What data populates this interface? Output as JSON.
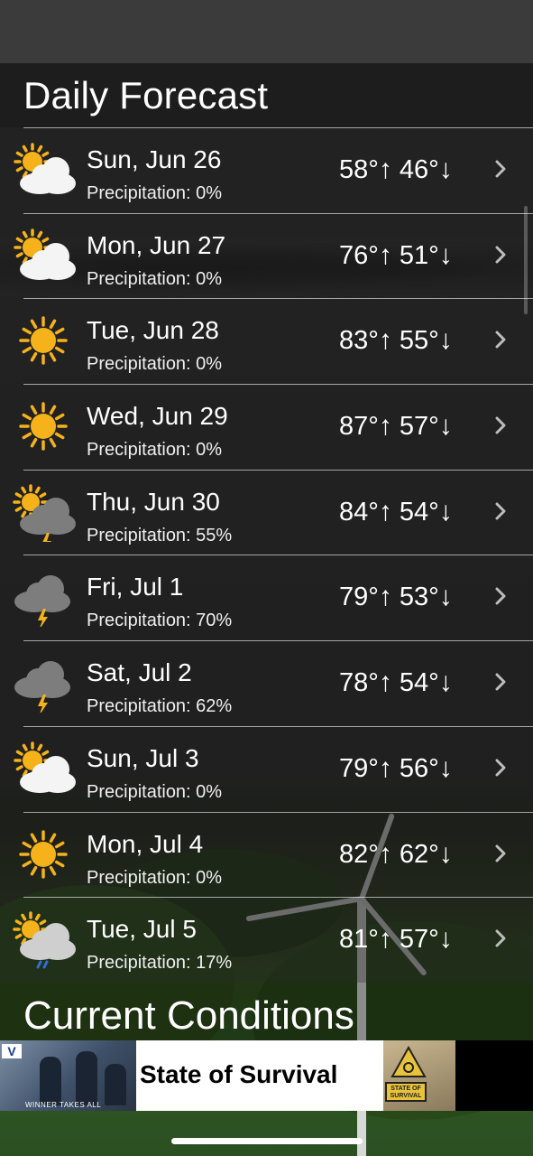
{
  "header": {
    "title": "Daily Forecast"
  },
  "units": {
    "high_arrow": "↑",
    "low_arrow": "↓",
    "deg": "°"
  },
  "forecast": [
    {
      "day": "Sun, Jun 26",
      "precipitation": "Precipitation: 0%",
      "high": "58°",
      "low": "46°",
      "icon": "partly-cloudy-icon"
    },
    {
      "day": "Mon, Jun 27",
      "precipitation": "Precipitation: 0%",
      "high": "76°",
      "low": "51°",
      "icon": "partly-cloudy-icon"
    },
    {
      "day": "Tue, Jun 28",
      "precipitation": "Precipitation: 0%",
      "high": "83°",
      "low": "55°",
      "icon": "sunny-icon"
    },
    {
      "day": "Wed, Jun 29",
      "precipitation": "Precipitation: 0%",
      "high": "87°",
      "low": "57°",
      "icon": "sunny-icon"
    },
    {
      "day": "Thu, Jun 30",
      "precipitation": "Precipitation: 55%",
      "high": "84°",
      "low": "54°",
      "icon": "partly-sunny-thunderstorm-icon"
    },
    {
      "day": "Fri, Jul 1",
      "precipitation": "Precipitation: 70%",
      "high": "79°",
      "low": "53°",
      "icon": "thunderstorm-icon"
    },
    {
      "day": "Sat, Jul 2",
      "precipitation": "Precipitation: 62%",
      "high": "78°",
      "low": "54°",
      "icon": "thunderstorm-icon"
    },
    {
      "day": "Sun, Jul 3",
      "precipitation": "Precipitation: 0%",
      "high": "79°",
      "low": "56°",
      "icon": "partly-cloudy-icon"
    },
    {
      "day": "Mon, Jul 4",
      "precipitation": "Precipitation: 0%",
      "high": "82°",
      "low": "62°",
      "icon": "sunny-icon"
    },
    {
      "day": "Tue, Jul 5",
      "precipitation": "Precipitation: 17%",
      "high": "81°",
      "low": "57°",
      "icon": "partly-sunny-rain-icon"
    }
  ],
  "current": {
    "title": "Current Conditions"
  },
  "ad": {
    "title": "State of Survival",
    "left_tagline": "WINNER TAKES ALL",
    "left_logo": "V",
    "right_badge": "STATE OF SURVIVAL"
  },
  "colors": {
    "sun": "#f5b21a",
    "cloud": "#f4f4f4",
    "storm_cloud": "#7d7d7d",
    "bolt": "#f2b61c",
    "rain": "#2f6fd8"
  }
}
